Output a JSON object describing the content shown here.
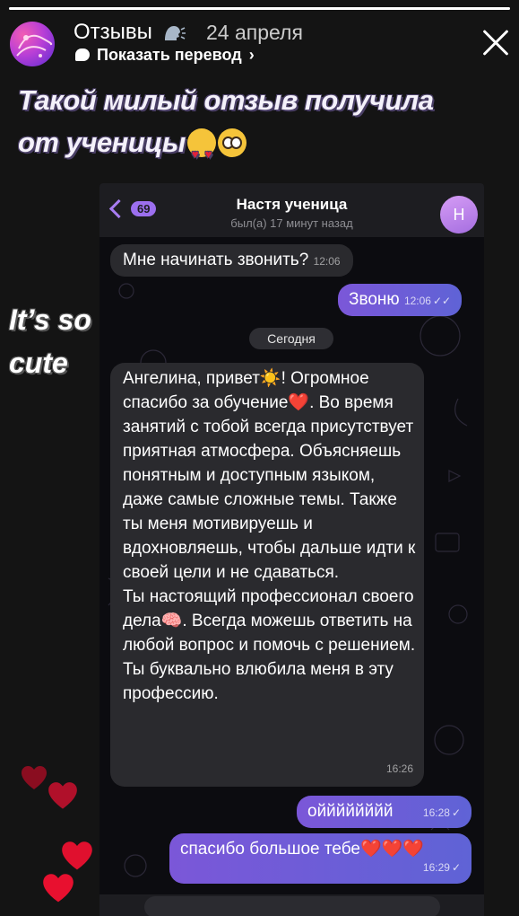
{
  "story": {
    "account_name": "Отзывы",
    "date": "24 апреля",
    "translate_label": "Показать перевод",
    "caption_line1": "Такой милый отзыв получила",
    "caption_line2": "от ученицы",
    "sticker_line1": "It’s so",
    "sticker_line2": "cute",
    "progress": 1.0,
    "heart_color": "#c8102e"
  },
  "chat": {
    "back_count": "69",
    "contact_name": "Настя ученица",
    "status": "был(а) 17 минут назад",
    "avatar_letter": "Н",
    "date_divider": "Сегодня",
    "messages": [
      {
        "dir": "in",
        "text": "Мне начинать звонить?",
        "time": "12:06"
      },
      {
        "dir": "out",
        "text": "Звоню",
        "time": "12:06"
      },
      {
        "dir": "in",
        "paragraphs": [
          "Ангелина, привет☀️! Огромное спасибо за обучение❤️. Во время занятий с тобой всегда присутствует приятная атмосфера. Объясняешь понятным и доступным языком, даже самые сложные темы. Также ты меня мотивируешь и вдохновляешь, чтобы дальше идти к своей цели и не сдаваться.",
          "Ты настоящий профессионал своего дела🧠. Всегда можешь ответить на любой вопрос и помочь с решением. Ты буквально влюбила меня в эту профессию."
        ],
        "time": "16:26"
      },
      {
        "dir": "out",
        "text": "ойййййййй",
        "time": "16:28"
      },
      {
        "dir": "out",
        "text": "спасибо большое тебе❤️❤️❤️",
        "time": "16:29"
      }
    ],
    "accent_color": "#9c6fef"
  }
}
